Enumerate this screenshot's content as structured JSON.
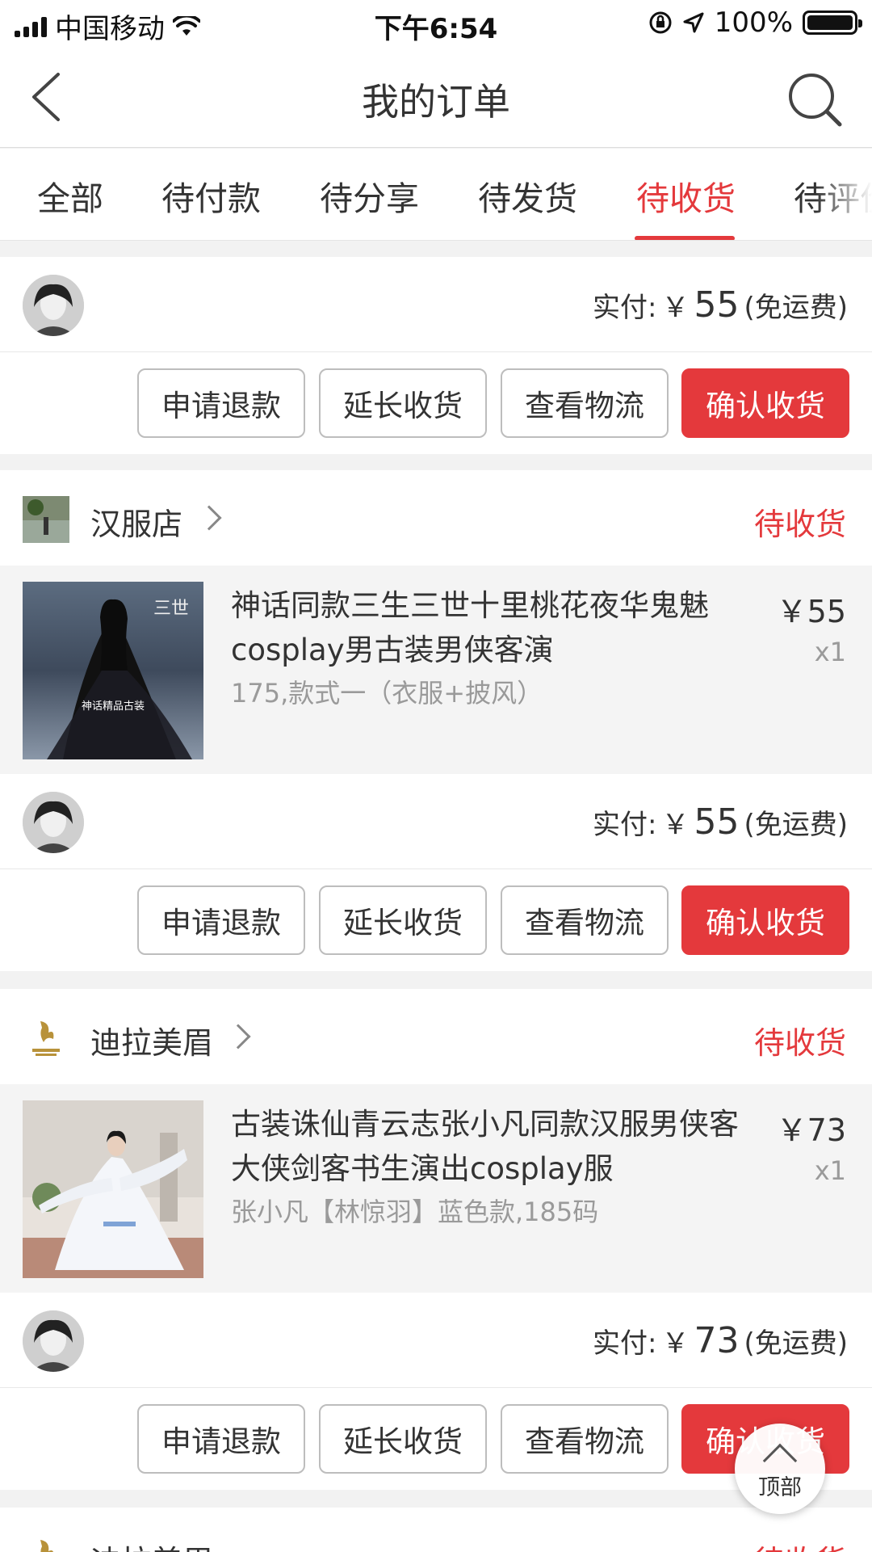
{
  "status_bar": {
    "carrier": "中国移动",
    "time": "下午6:54",
    "battery": "100%"
  },
  "nav": {
    "title": "我的订单"
  },
  "tabs": [
    "全部",
    "待付款",
    "待分享",
    "待发货",
    "待收货",
    "待评价"
  ],
  "active_tab": "待收货",
  "orders": [
    {
      "shop": null,
      "paid_label": "实付:",
      "currency": "￥",
      "amount": "55",
      "shipping": "(免运费)",
      "actions": [
        "申请退款",
        "延长收货",
        "查看物流",
        "确认收货"
      ]
    },
    {
      "shop": {
        "name": "汉服店",
        "status": "待收货"
      },
      "item": {
        "title": "神话同款三生三世十里桃花夜华鬼魅cosplay男古装男侠客演",
        "spec": "175,款式一（衣服+披风）",
        "price": "￥55",
        "qty": "x1",
        "image_caption": "神话精品古装"
      },
      "paid_label": "实付:",
      "currency": "￥",
      "amount": "55",
      "shipping": "(免运费)",
      "actions": [
        "申请退款",
        "延长收货",
        "查看物流",
        "确认收货"
      ]
    },
    {
      "shop": {
        "name": "迪拉美眉",
        "status": "待收货"
      },
      "item": {
        "title": "古装诛仙青云志张小凡同款汉服男侠客大侠剑客书生演出cosplay服",
        "spec": "张小凡【林惊羽】蓝色款,185码",
        "price": "￥73",
        "qty": "x1"
      },
      "paid_label": "实付:",
      "currency": "￥",
      "amount": "73",
      "shipping": "(免运费)",
      "actions": [
        "申请退款",
        "延长收货",
        "查看物流",
        "确认收货"
      ]
    },
    {
      "shop": {
        "name": "迪拉美眉",
        "status": "待收货"
      }
    }
  ],
  "back_to_top": "顶部",
  "colors": {
    "accent": "#e4393c",
    "background": "#f2f2f2"
  }
}
